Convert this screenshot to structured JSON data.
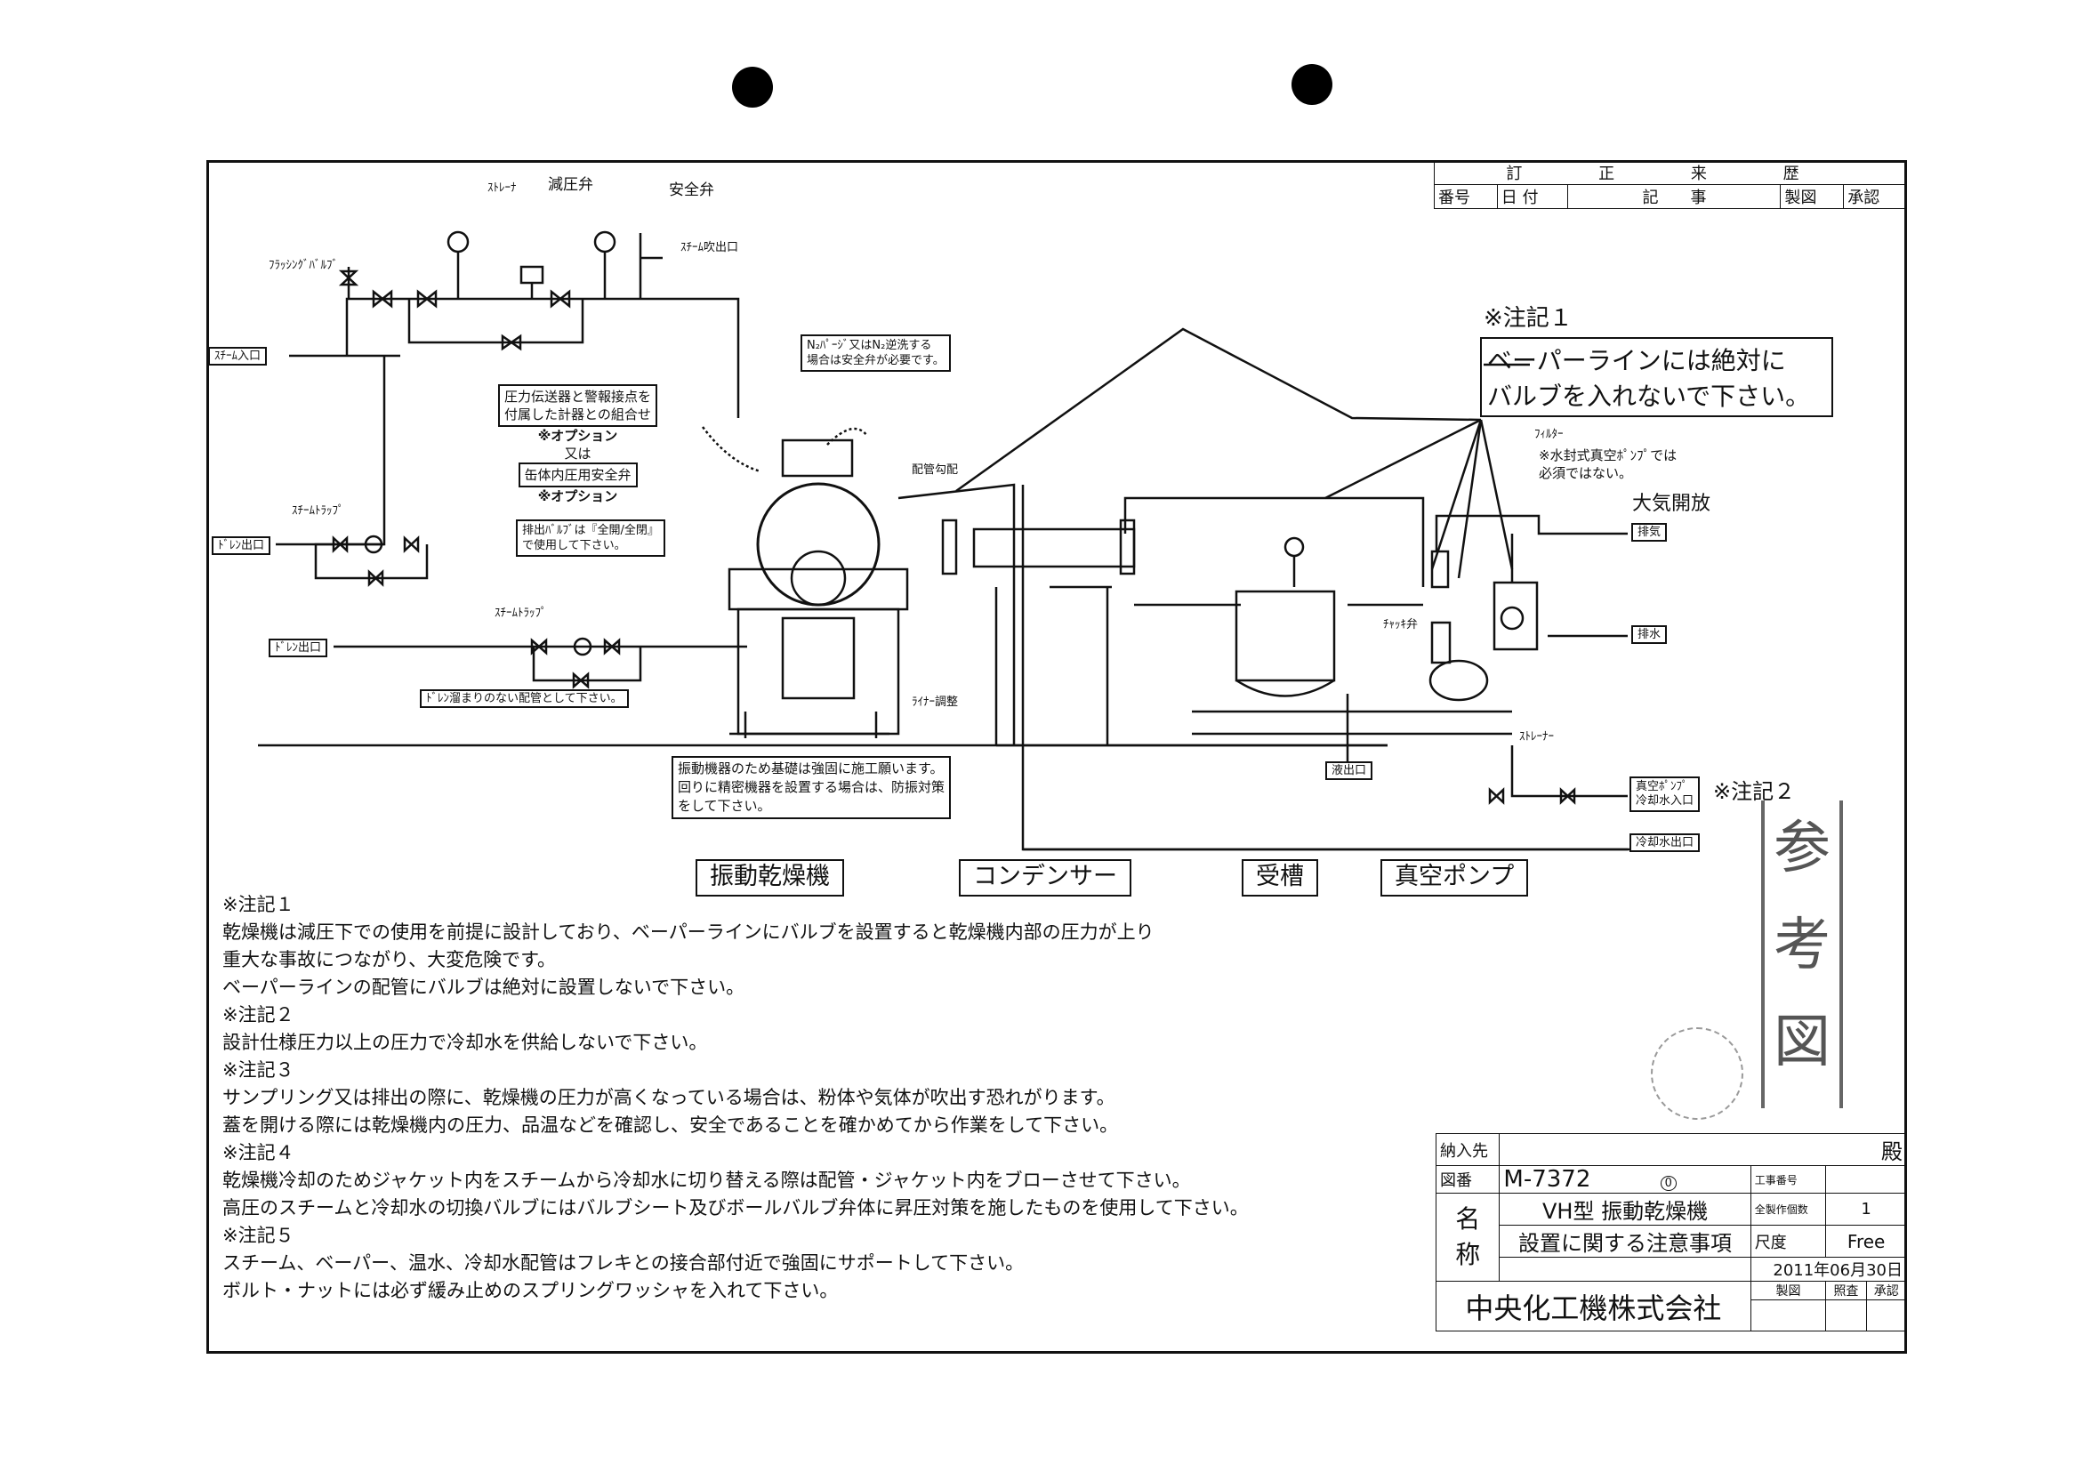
{
  "revision": {
    "title_chars": [
      "訂",
      "正",
      "来",
      "歴"
    ],
    "cols": [
      "番号",
      "日 付",
      "記　　事",
      "製図",
      "承認"
    ]
  },
  "labels": {
    "flushing_valve": "ﾌﾗｯｼﾝｸﾞﾊﾞﾙﾌﾞ",
    "strainer": "ｽﾄﾚｰﾅ",
    "reducing_valve": "減圧弁",
    "safety_valve": "安全弁",
    "steam_blow": "ｽﾁｰﾑ吹出口",
    "steam_inlet": "ｽﾁｰﾑ入口",
    "steam_trap_1": "ｽﾁｰﾑﾄﾗｯﾌﾟ",
    "steam_trap_2": "ｽﾁｰﾑﾄﾗｯﾌﾟ",
    "drain_1": "ﾄﾞﾚﾝ出口",
    "drain_2": "ﾄﾞﾚﾝ出口",
    "drain_note": "ﾄﾞﾚﾝ溜まりのない配管として下さい。",
    "n2_note_1": "N₂ﾊﾟｰｼﾞ又はN₂逆洗する",
    "n2_note_2": "場合は安全弁が必要です。",
    "option_1": "圧力伝送器と警報接点を",
    "option_2": "付属した計器との組合せ",
    "option_3": "※オプション",
    "option_or": "又は",
    "option_4": "缶体内圧用安全弁",
    "option_5": "※オプション",
    "exhaust_1": "排出ﾊﾞﾙﾌﾞは『全開/全閉』",
    "exhaust_2": "で使用して下さい。",
    "pipe_slope": "配管勾配",
    "liner": "ﾗｲﾅｰ調整",
    "foundation_1": "振動機器のため基礎は強固に施工願います。",
    "foundation_2": "回りに精密機器を設置する場合は、防振対策",
    "foundation_3": "をして下さい。",
    "note1_title": "※注記１",
    "note1_1": "ベーパーラインには絶対に",
    "note1_2": "バルブを入れないで下さい。",
    "filter": "ﾌｨﾙﾀｰ",
    "filter_note_1": "※水封式真空ﾎﾟﾝﾌﾟでは",
    "filter_note_2": "必須ではない。",
    "atmos": "大気開放",
    "exhaust_out": "排気",
    "drain_water": "排水",
    "check_valve": "ﾁｬｯｷ弁",
    "strainer_2": "ｽﾄﾚｰﾅｰ",
    "liquid_out": "液出口",
    "vac_cool_in_1": "真空ﾎﾟﾝﾌﾟ",
    "vac_cool_in_2": "冷却水入口",
    "note2": "※注記２",
    "cool_out": "冷却水出口"
  },
  "captions": [
    "振動乾燥機",
    "コンデンサー",
    "受槽",
    "真空ポンプ"
  ],
  "notes": [
    "※注記１",
    "乾燥機は減圧下での使用を前提に設計しており、ベーパーラインにバルブを設置すると乾燥機内部の圧力が上り",
    "重大な事故につながり、大変危険です。",
    "ベーパーラインの配管にバルブは絶対に設置しないで下さい。",
    "※注記２",
    "設計仕様圧力以上の圧力で冷却水を供給しないで下さい。",
    "※注記３",
    "サンプリング又は排出の際に、乾燥機の圧力が高くなっている場合は、粉体や気体が吹出す恐れがります。",
    "蓋を開ける際には乾燥機内の圧力、品温などを確認し、安全であることを確かめてから作業をして下さい。",
    "※注記４",
    "乾燥機冷却のためジャケット内をスチームから冷却水に切り替える際は配管・ジャケット内をブローさせて下さい。",
    "高圧のスチームと冷却水の切換バルブにはバルブシート及びボールバルブ弁体に昇圧対策を施したものを使用して下さい。",
    "※注記５",
    "スチーム、ベーパー、温水、冷却水配管はフレキとの接合部付近で強固にサポートして下さい。",
    "ボルト・ナットには必ず緩み止めのスプリングワッシャを入れて下さい。"
  ],
  "titleblock": {
    "customer_label": "納入先",
    "customer_suffix": "殿",
    "drawing_no_label": "図番",
    "drawing_no": "M-7372",
    "rev": "0",
    "work_no_label": "工事番号",
    "qty_label": "全製作個数",
    "qty": "1",
    "name_label_1": "名",
    "name_label_2": "称",
    "name_1": "VH型 振動乾燥機",
    "name_2": "設置に関する注意事項",
    "scale_label": "尺度",
    "scale": "Free",
    "date": "2011年06月30日",
    "drawn": "製図",
    "checked": "照査",
    "approved": "承認",
    "company": "中央化工機株式会社"
  },
  "stamp": [
    "参",
    "考",
    "図"
  ]
}
